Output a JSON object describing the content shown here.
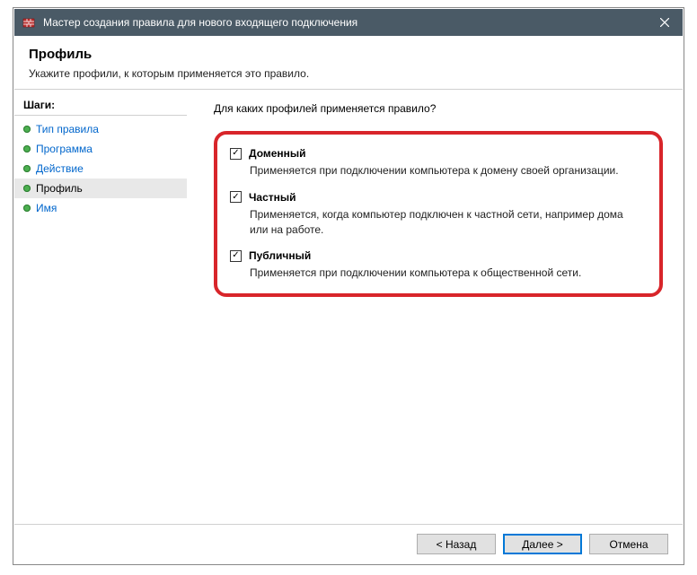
{
  "window": {
    "title": "Мастер создания правила для нового входящего подключения"
  },
  "header": {
    "title": "Профиль",
    "subtitle": "Укажите профили, к которым применяется это правило."
  },
  "steps": {
    "header": "Шаги:",
    "items": [
      {
        "label": "Тип правила"
      },
      {
        "label": "Программа"
      },
      {
        "label": "Действие"
      },
      {
        "label": "Профиль"
      },
      {
        "label": "Имя"
      }
    ]
  },
  "content": {
    "question": "Для каких профилей применяется правило?",
    "profiles": [
      {
        "label": "Доменный",
        "description": "Применяется при подключении компьютера к домену своей организации."
      },
      {
        "label": "Частный",
        "description": "Применяется, когда компьютер подключен к частной сети, например дома или на работе."
      },
      {
        "label": "Публичный",
        "description": "Применяется при подключении компьютера к общественной сети."
      }
    ]
  },
  "footer": {
    "back": "< Назад",
    "next": "Далее >",
    "cancel": "Отмена"
  }
}
